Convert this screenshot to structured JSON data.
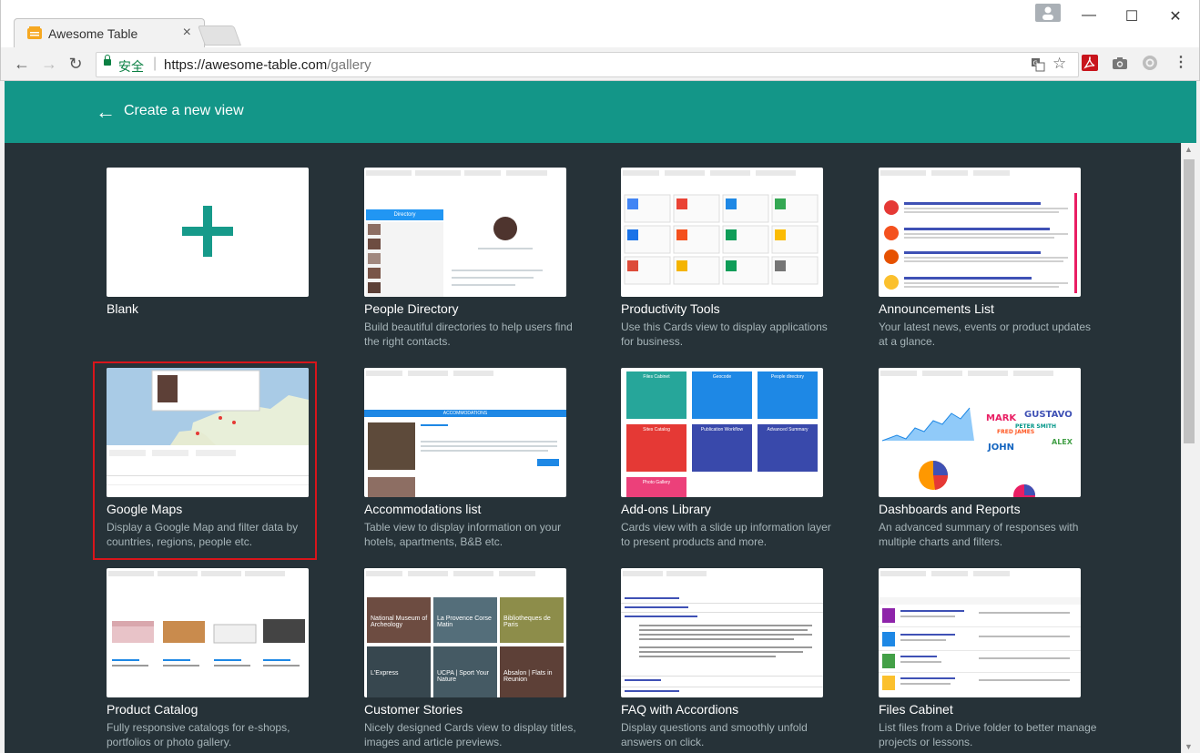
{
  "browser": {
    "tab_title": "Awesome Table",
    "tab_close": "×",
    "secure_label": "安全",
    "url_base": "https://awesome-table.com",
    "url_path": "/gallery",
    "window_buttons": {
      "minimize": "—",
      "maximize": "☐",
      "close": "✕"
    }
  },
  "header": {
    "back_label": "←",
    "title": "Create a new view"
  },
  "gallery": {
    "cards": [
      {
        "title": "Blank",
        "description": ""
      },
      {
        "title": "People Directory",
        "description": "Build beautiful directories to help users find the right contacts."
      },
      {
        "title": "Productivity Tools",
        "description": "Use this Cards view to display applications for business."
      },
      {
        "title": "Announcements List",
        "description": "Your latest news, events or product updates at a glance."
      },
      {
        "title": "Google Maps",
        "description": "Display a Google Map and filter data by countries, regions, people etc."
      },
      {
        "title": "Accommodations list",
        "description": "Table view to display information on your hotels, apartments, B&B etc."
      },
      {
        "title": "Add-ons Library",
        "description": "Cards view with a slide up information layer to present products and more."
      },
      {
        "title": "Dashboards and Reports",
        "description": "An advanced summary of responses with multiple charts and filters."
      },
      {
        "title": "Product Catalog",
        "description": "Fully responsive catalogs for e-shops, portfolios or photo gallery."
      },
      {
        "title": "Customer Stories",
        "description": "Nicely designed Cards view to display titles, images and article previews."
      },
      {
        "title": "FAQ with Accordions",
        "description": "Display questions and smoothly unfold answers on click."
      },
      {
        "title": "Files Cabinet",
        "description": "List files from a Drive folder to better manage projects or lessons."
      }
    ],
    "thumb_text": {
      "directory": "Directory",
      "accommodations": "ACCOMMODATIONS",
      "addon_tiles": [
        "Files Cabinet",
        "Geocode",
        "People directory",
        "Sites Catalog",
        "Publication Workflow",
        "Advanced Summary",
        "Photo Gallery"
      ],
      "story_tiles": [
        "National Museum of Archeology",
        "La Provence Corse Matin",
        "Bibliotheques de Paris",
        "L'Express",
        "UCPA | Sport Your Nature",
        "Absalon | Flats in Reunion"
      ]
    }
  },
  "colors": {
    "header": "#139688",
    "gallery_bg": "#263238",
    "selection": "#d8151b"
  }
}
